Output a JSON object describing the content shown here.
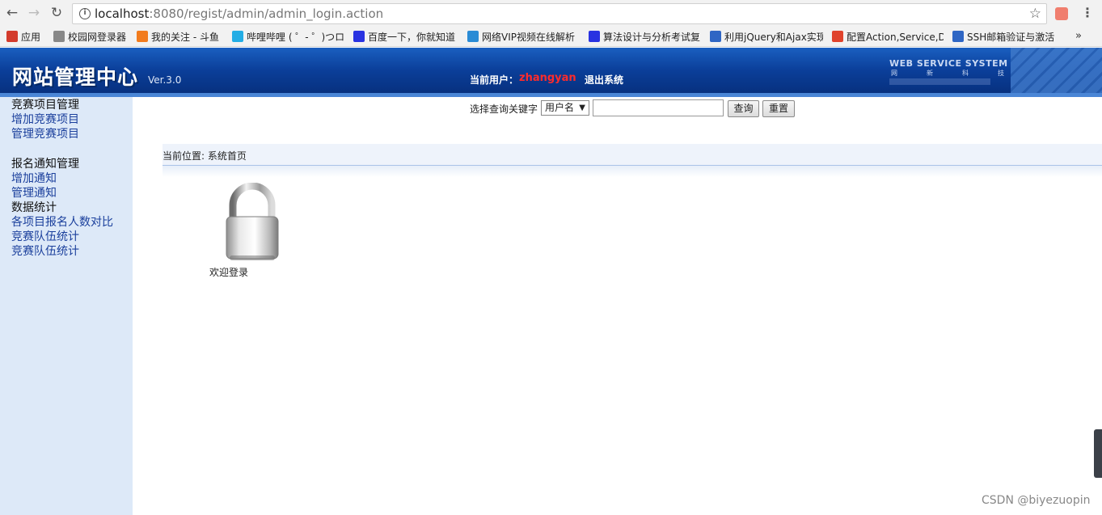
{
  "browser": {
    "url_host": "localhost",
    "url_path": ":8080/regist/admin/admin_login.action",
    "bookmarks": [
      {
        "label": "应用",
        "icon": "apps-grid-icon",
        "color": "#d33b2c"
      },
      {
        "label": "校园网登录器",
        "icon": "page-icon",
        "color": "#888888"
      },
      {
        "label": "我的关注 - 斗鱼",
        "icon": "douyu-icon",
        "color": "#f27b1d"
      },
      {
        "label": "哔哩哔哩 ( ゜- ゜)つロ",
        "icon": "bilibili-icon",
        "color": "#23ade5"
      },
      {
        "label": "百度一下，你就知道",
        "icon": "baidu-paw-icon",
        "color": "#2932e1"
      },
      {
        "label": "网络VIP视频在线解析",
        "icon": "globe-icon",
        "color": "#2a8bd5"
      },
      {
        "label": "算法设计与分析考试复",
        "icon": "baidu-paw-icon",
        "color": "#2932e1"
      },
      {
        "label": "利用jQuery和Ajax实现",
        "icon": "globe-icon",
        "color": "#2f66c4"
      },
      {
        "label": "配置Action,Service,D",
        "icon": "flame-icon",
        "color": "#e0432c"
      },
      {
        "label": "SSH邮箱验证与激活",
        "icon": "globe-icon",
        "color": "#2f66c4"
      }
    ],
    "more_label": "»"
  },
  "header": {
    "title": "网站管理中心",
    "version": "Ver.3.0",
    "user_label": "当前用户：",
    "user_name": "zhangyan",
    "logout": "退出系统",
    "brand_title": "WEB SERVICE SYSTEM",
    "brand_sub": [
      "网",
      "新",
      "科",
      "技"
    ]
  },
  "sidebar": {
    "items": [
      {
        "label": "竞赛项目管理",
        "kind": "head"
      },
      {
        "label": "增加竞赛项目",
        "kind": "link"
      },
      {
        "label": "管理竞赛项目",
        "kind": "link"
      },
      {
        "label": "报名通知管理",
        "kind": "head"
      },
      {
        "label": "增加通知",
        "kind": "link"
      },
      {
        "label": "管理通知",
        "kind": "link"
      },
      {
        "label": "数据统计",
        "kind": "head"
      },
      {
        "label": "各项目报名人数对比",
        "kind": "link"
      },
      {
        "label": "竞赛队伍统计",
        "kind": "link"
      },
      {
        "label": "竞赛队伍统计",
        "kind": "link"
      }
    ]
  },
  "search": {
    "label": "选择查询关键字",
    "select_value": "用户名",
    "input_value": "",
    "query_button": "查询",
    "reset_button": "重置"
  },
  "main": {
    "breadcrumb": "当前位置: 系统首页",
    "welcome": "欢迎登录"
  },
  "watermark": "CSDN @biyezuopin"
}
